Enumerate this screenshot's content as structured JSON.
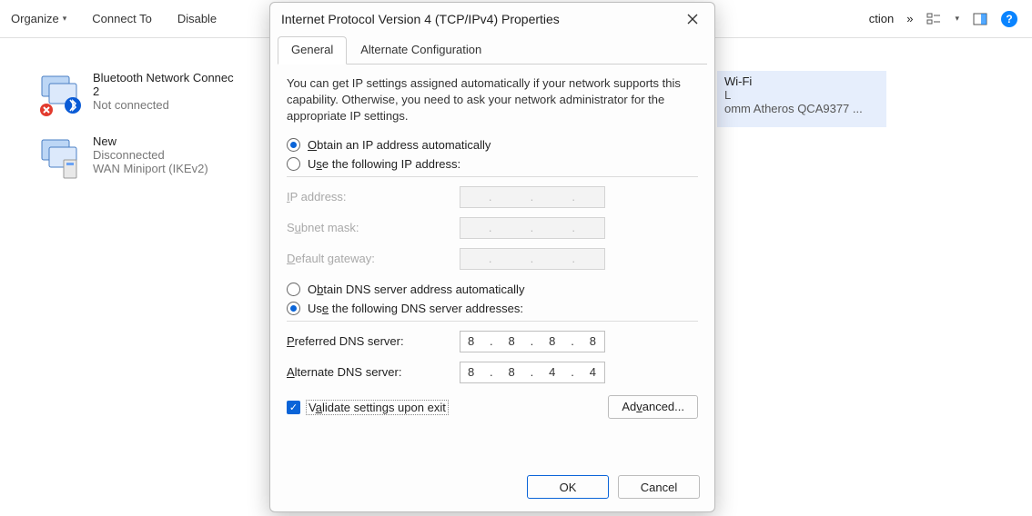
{
  "toolbar": {
    "organize": "Organize",
    "connect": "Connect To",
    "disable": "Disable",
    "extra_text": "ction",
    "more": "»"
  },
  "network_items": [
    {
      "name": "Bluetooth Network Connec",
      "sub": "2",
      "status": "Not connected"
    },
    {
      "name": "New",
      "status": "Disconnected",
      "detail": "WAN Miniport (IKEv2)"
    }
  ],
  "wifi": {
    "name": "Wi-Fi",
    "sub": "L",
    "detail": "omm Atheros QCA9377 ..."
  },
  "dialog": {
    "title": "Internet Protocol Version 4 (TCP/IPv4) Properties",
    "tabs": {
      "general": "General",
      "alt": "Alternate Configuration"
    },
    "desc": "You can get IP settings assigned automatically if your network supports this capability. Otherwise, you need to ask your network administrator for the appropriate IP settings.",
    "ip_section": {
      "auto_label": "Obtain an IP address automatically",
      "manual_label": "Use the following IP address:",
      "selected": "auto",
      "ip_label": "IP address:",
      "mask_label": "Subnet mask:",
      "gw_label": "Default gateway:",
      "ip": [
        "",
        "",
        "",
        ""
      ],
      "mask": [
        "",
        "",
        "",
        ""
      ],
      "gw": [
        "",
        "",
        "",
        ""
      ]
    },
    "dns_section": {
      "auto_label": "Obtain DNS server address automatically",
      "manual_label": "Use the following DNS server addresses:",
      "selected": "manual",
      "pref_label": "Preferred DNS server:",
      "alt_label": "Alternate DNS server:",
      "pref": [
        "8",
        "8",
        "8",
        "8"
      ],
      "alt": [
        "8",
        "8",
        "4",
        "4"
      ]
    },
    "validate_label": "Validate settings upon exit",
    "validate_checked": true,
    "advanced": "Advanced...",
    "ok": "OK",
    "cancel": "Cancel"
  }
}
